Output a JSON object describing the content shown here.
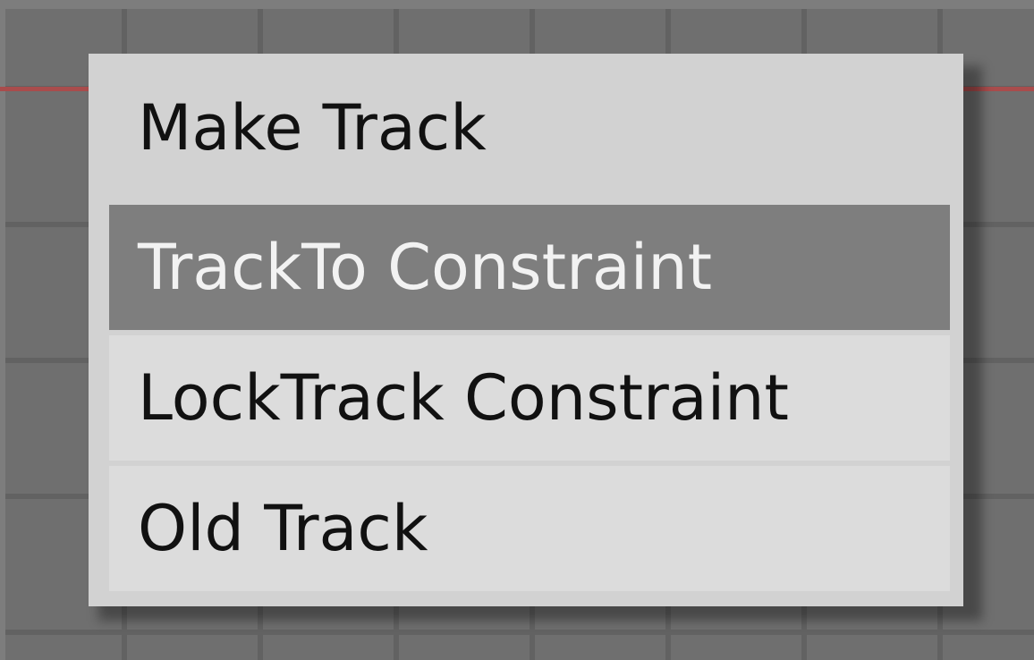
{
  "menu": {
    "title": "Make Track",
    "items": [
      {
        "label": "TrackTo Constraint",
        "highlighted": true
      },
      {
        "label": "LockTrack Constraint",
        "highlighted": false
      },
      {
        "label": "Old Track",
        "highlighted": false
      }
    ]
  },
  "colors": {
    "viewport_background": "#6f6f6f",
    "grid_line": "#626262",
    "x_axis_line": "#a94c4c",
    "menu_background": "#d2d2d2",
    "item_background": "#dcdcdc",
    "item_highlight": "#7e7e7e",
    "text": "#111111",
    "text_highlight": "#f2f2f2"
  }
}
